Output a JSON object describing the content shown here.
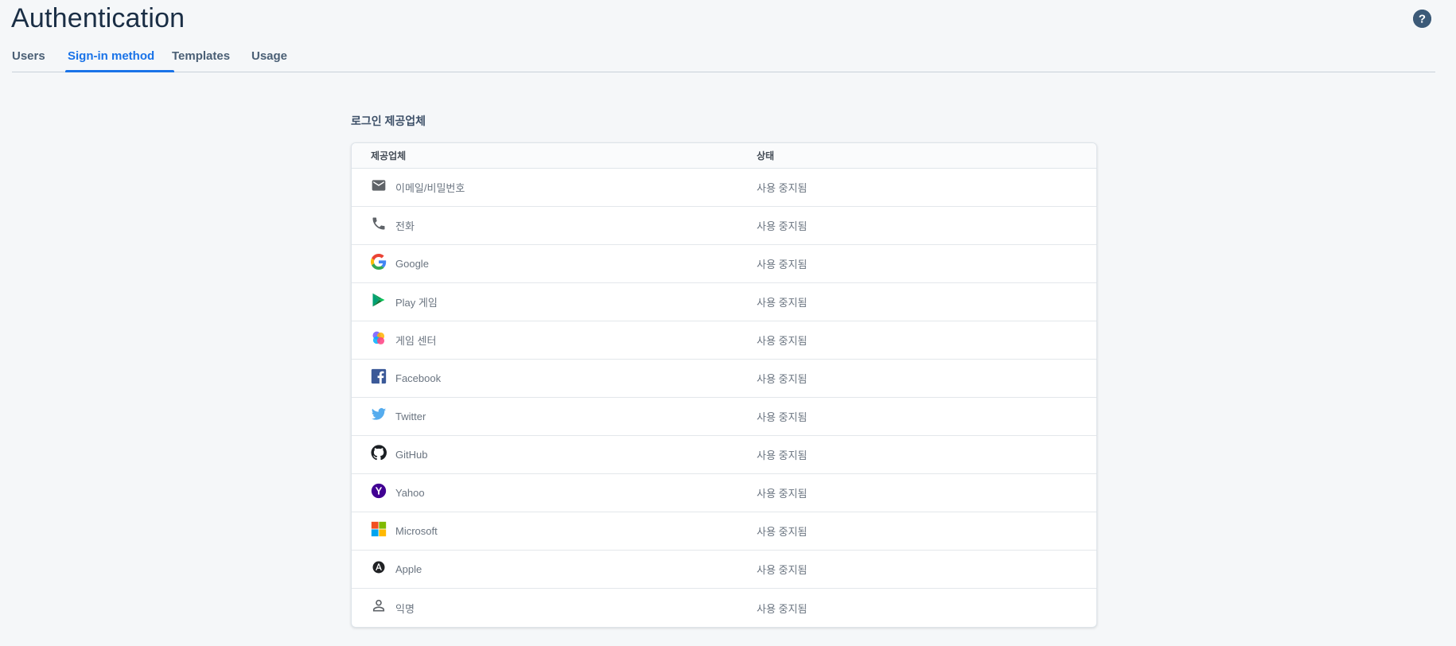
{
  "page": {
    "title": "Authentication",
    "help_label": "?"
  },
  "tabs": [
    {
      "label": "Users",
      "active": false
    },
    {
      "label": "Sign-in method",
      "active": true
    },
    {
      "label": "Templates",
      "active": false
    },
    {
      "label": "Usage",
      "active": false
    }
  ],
  "providers_section": {
    "title": "로그인 제공업체",
    "columns": {
      "provider": "제공업체",
      "status": "상태"
    },
    "rows": [
      {
        "icon": "email-icon",
        "name": "이메일/비밀번호",
        "status": "사용 중지됨"
      },
      {
        "icon": "phone-icon",
        "name": "전화",
        "status": "사용 중지됨"
      },
      {
        "icon": "google-icon",
        "name": "Google",
        "status": "사용 중지됨"
      },
      {
        "icon": "play-games-icon",
        "name": "Play 게임",
        "status": "사용 중지됨"
      },
      {
        "icon": "game-center-icon",
        "name": "게임 센터",
        "status": "사용 중지됨"
      },
      {
        "icon": "facebook-icon",
        "name": "Facebook",
        "status": "사용 중지됨"
      },
      {
        "icon": "twitter-icon",
        "name": "Twitter",
        "status": "사용 중지됨"
      },
      {
        "icon": "github-icon",
        "name": "GitHub",
        "status": "사용 중지됨"
      },
      {
        "icon": "yahoo-icon",
        "name": "Yahoo",
        "status": "사용 중지됨"
      },
      {
        "icon": "microsoft-icon",
        "name": "Microsoft",
        "status": "사용 중지됨"
      },
      {
        "icon": "apple-icon",
        "name": "Apple",
        "status": "사용 중지됨"
      },
      {
        "icon": "anonymous-icon",
        "name": "익명",
        "status": "사용 중지됨"
      }
    ]
  },
  "colors": {
    "accent": "#1a73e8",
    "title": "#1a2e45",
    "background": "#f5f7f9"
  }
}
